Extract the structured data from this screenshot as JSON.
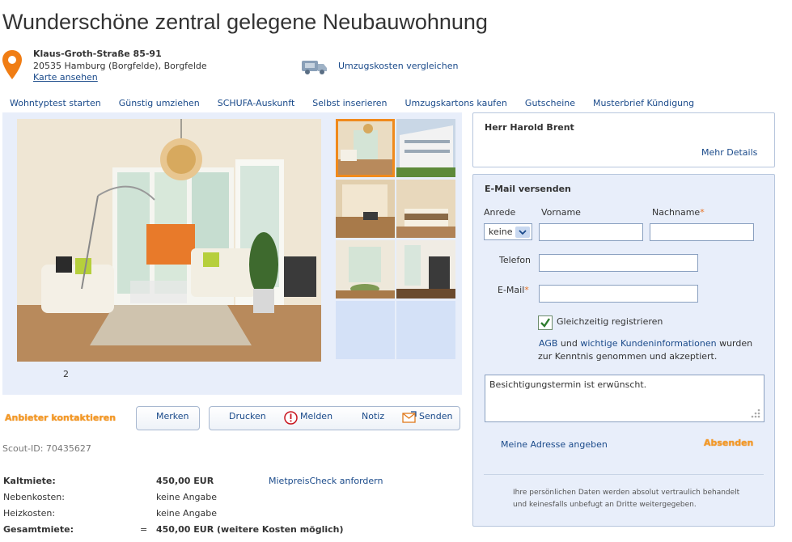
{
  "listing": {
    "title": "Wunderschöne zentral gelegene Neubauwohnung",
    "street": "Klaus-Groth-Straße 85-91",
    "city": "20535 Hamburg (Borgfelde), Borgfelde",
    "map_link": "Karte ansehen",
    "compare_moving": "Umzugskosten vergleichen"
  },
  "nav": {
    "items": [
      "Wohntyptest starten",
      "Günstig umziehen",
      "SCHUFA-Auskunft",
      "Selbst inserieren",
      "Umzugskartons kaufen",
      "Gutscheine",
      "Musterbrief Kündigung"
    ]
  },
  "gallery": {
    "counter": "2"
  },
  "actions": {
    "contact": "Anbieter kontaktieren",
    "save": "Merken",
    "print": "Drucken",
    "report": "Melden",
    "note": "Notiz",
    "send": "Senden"
  },
  "scout_id": "Scout-ID: 70435627",
  "prices": {
    "cold_label": "Kaltmiete:",
    "cold_value": "450,00 EUR",
    "check_link": "MietpreisCheck anfordern",
    "extra_label": "Nebenkosten:",
    "extra_value": "keine Angabe",
    "heating_label": "Heizkosten:",
    "heating_value": "keine Angabe",
    "total_label": "Gesamtmiete:",
    "total_eq": "=",
    "total_value": "450,00 EUR (weitere Kosten möglich)"
  },
  "agent": {
    "name": "Herr Harold Brent",
    "details": "Mehr Details"
  },
  "form": {
    "heading": "E-Mail versenden",
    "salutation_label": "Anrede",
    "salutation_value": "keine",
    "firstname_label": "Vorname",
    "lastname_label": "Nachname",
    "required_mark": "*",
    "phone_label": "Telefon",
    "email_label": "E-Mail",
    "register_label": "Gleichzeitig registrieren",
    "terms_agb": "AGB",
    "terms_and": " und ",
    "terms_info": "wichtige Kundeninformationen",
    "terms_rest1": " wurden",
    "terms_rest2": "zur Kenntnis genommen und akzeptiert.",
    "message": "Besichtigungstermin ist erwünscht.",
    "address_link": "Meine Adresse angeben",
    "submit": "Absenden",
    "privacy1": "Ihre persönlichen Daten werden absolut vertraulich behandelt",
    "privacy2": "und keinesfalls unbefugt an Dritte weitergegeben."
  },
  "colors": {
    "accent_orange": "#f08a1c",
    "link_blue": "#1a4a8a",
    "panel_blue": "#e8eefa"
  }
}
